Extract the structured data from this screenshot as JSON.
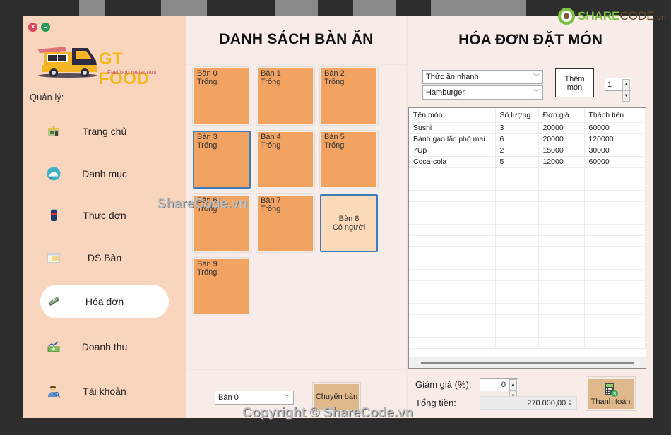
{
  "watermark": {
    "logo_part1": "SHARE",
    "logo_part2": "CODE",
    "logo_part3": ".vn",
    "center_text": "ShareCode.vn",
    "bottom_text": "Copyright © ShareCode.vn"
  },
  "window": {
    "close_icon": "×",
    "minimize_icon": "–"
  },
  "sidebar": {
    "brand_title": "GT FOOD",
    "brand_subtitle": "Fastfood restaurant",
    "section_label": "Quản lý:",
    "items": [
      {
        "label": "Trang chủ",
        "icon": "store-icon",
        "active": false
      },
      {
        "label": "Danh mục",
        "icon": "food-cover-icon",
        "active": false
      },
      {
        "label": "Thực đơn",
        "icon": "drink-can-icon",
        "active": false
      },
      {
        "label": "DS Bàn",
        "icon": "table-list-icon",
        "active": false
      },
      {
        "label": "Hóa đơn",
        "icon": "money-icon",
        "active": true
      },
      {
        "label": "Doanh thu",
        "icon": "revenue-chart-icon",
        "active": false
      },
      {
        "label": "Tài khoản",
        "icon": "user-search-icon",
        "active": false
      }
    ]
  },
  "tables_panel": {
    "title": "DANH SÁCH BÀN ĂN",
    "tables": [
      {
        "name": "Bàn 0",
        "status": "Trống"
      },
      {
        "name": "Bàn 1",
        "status": "Trống"
      },
      {
        "name": "Bàn 2",
        "status": "Trống"
      },
      {
        "name": "Bàn 3",
        "status": "Trống"
      },
      {
        "name": "Bàn 4",
        "status": "Trống"
      },
      {
        "name": "Bàn 5",
        "status": "Trống"
      },
      {
        "name": "Bàn 6",
        "status": "Trống"
      },
      {
        "name": "Bàn 7",
        "status": "Trống"
      },
      {
        "name": "Bàn 8",
        "status": "Có người"
      },
      {
        "name": "Bàn 9",
        "status": "Trống"
      }
    ],
    "switch_table_select": "Bàn 0",
    "switch_table_button": "Chuyển bàn"
  },
  "order_panel": {
    "title": "HÓA ĐƠN ĐẶT MÓN",
    "category_select": "Thức ăn nhanh",
    "food_select": "Hamburger",
    "add_button": "Thêm món",
    "quantity": "1",
    "columns": [
      "Tên món",
      "Số lượng",
      "Đơn giá",
      "Thành tiền"
    ],
    "rows": [
      [
        "Sushi",
        "3",
        "20000",
        "60000"
      ],
      [
        "Bánh gạo lắc phô mai",
        "6",
        "20000",
        "120000"
      ],
      [
        "7Up",
        "2",
        "15000",
        "30000"
      ],
      [
        "Coca-cola",
        "5",
        "12000",
        "60000"
      ]
    ],
    "discount_label": "Giảm giá (%):",
    "discount_value": "0",
    "total_label": "Tổng tiền:",
    "total_value": "270.000,00 ₫",
    "checkout_button": "Thanh toán"
  }
}
